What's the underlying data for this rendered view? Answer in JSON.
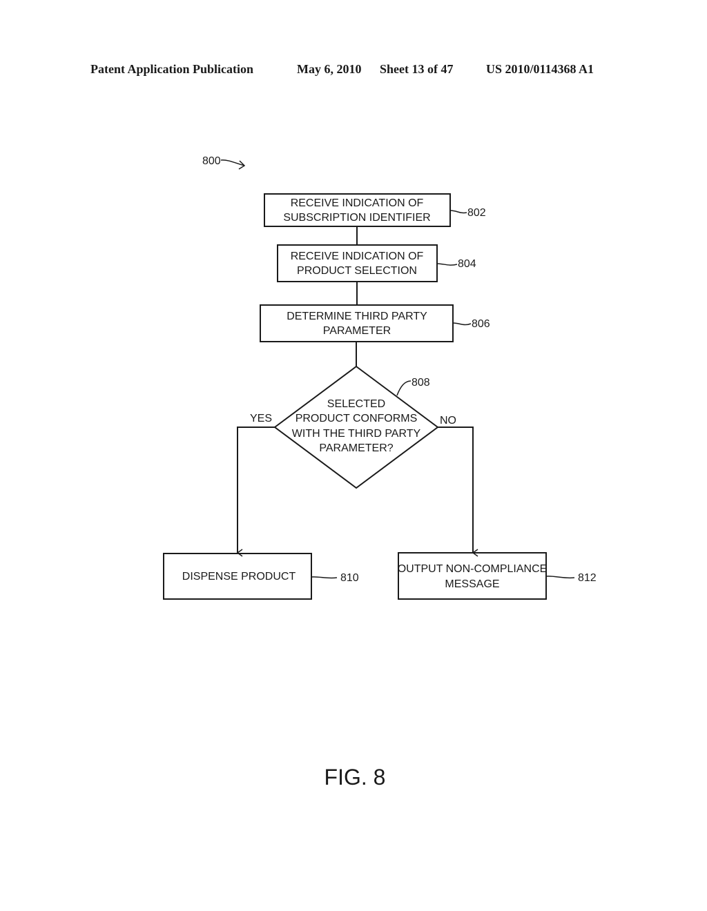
{
  "header": {
    "publication": "Patent Application Publication",
    "date": "May 6, 2010",
    "sheet": "Sheet 13 of 47",
    "number": "US 2010/0114368 A1"
  },
  "figure": {
    "ref": "800",
    "caption": "FIG. 8"
  },
  "nodes": {
    "n802": {
      "ref": "802",
      "lines": [
        "RECEIVE INDICATION OF",
        "SUBSCRIPTION IDENTIFIER"
      ]
    },
    "n804": {
      "ref": "804",
      "lines": [
        "RECEIVE INDICATION OF",
        "PRODUCT SELECTION"
      ]
    },
    "n806": {
      "ref": "806",
      "lines": [
        "DETERMINE THIRD PARTY",
        "PARAMETER"
      ]
    },
    "n808": {
      "ref": "808",
      "lines": [
        "SELECTED",
        "PRODUCT CONFORMS",
        "WITH THE THIRD PARTY",
        "PARAMETER?"
      ]
    },
    "n810": {
      "ref": "810",
      "lines": [
        "DISPENSE PRODUCT"
      ]
    },
    "n812": {
      "ref": "812",
      "lines": [
        "OUTPUT NON-COMPLIANCE",
        "MESSAGE"
      ]
    }
  },
  "branches": {
    "yes": "YES",
    "no": "NO"
  }
}
